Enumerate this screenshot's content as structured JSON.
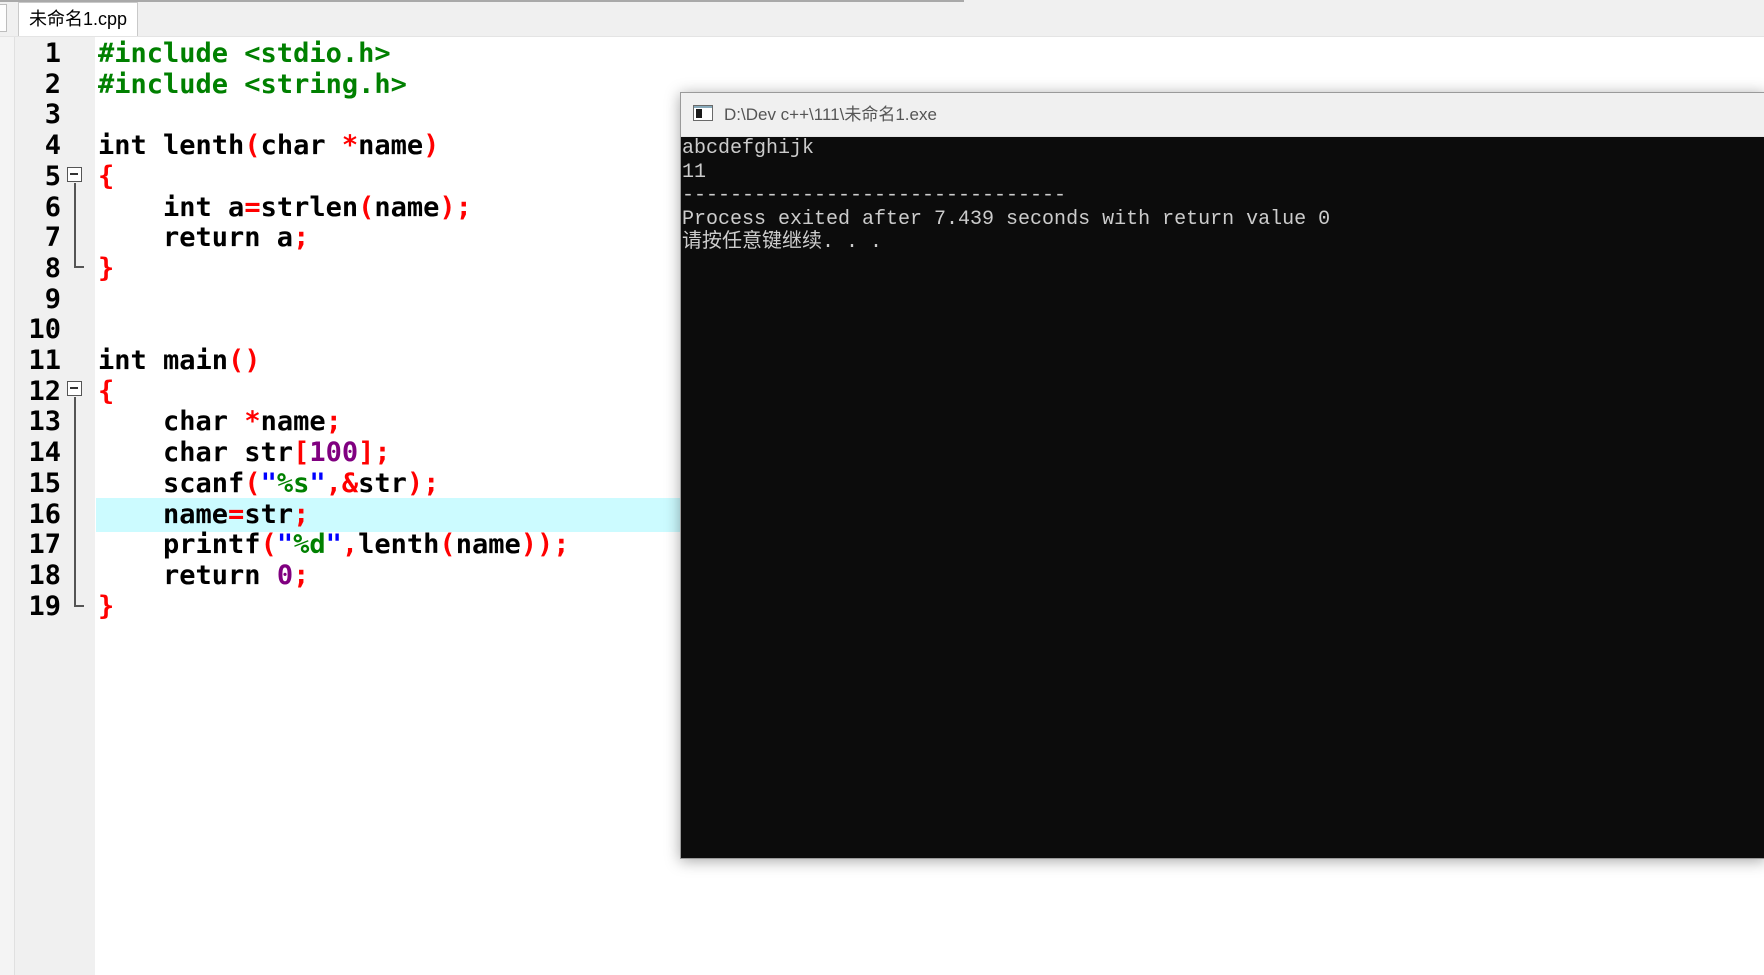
{
  "tab": {
    "label": "未命名1.cpp"
  },
  "editor": {
    "lines": [
      {
        "n": "1",
        "tokens": [
          [
            "pre",
            "#include <stdio.h>"
          ]
        ]
      },
      {
        "n": "2",
        "tokens": [
          [
            "pre",
            "#include <string.h>"
          ]
        ]
      },
      {
        "n": "3",
        "tokens": []
      },
      {
        "n": "4",
        "tokens": [
          [
            "kw",
            "int"
          ],
          [
            "kw",
            " lenth"
          ],
          [
            "op",
            "("
          ],
          [
            "kw",
            "char "
          ],
          [
            "op",
            "*"
          ],
          [
            "kw",
            "name"
          ],
          [
            "op",
            ")"
          ]
        ]
      },
      {
        "n": "5",
        "tokens": [
          [
            "op",
            "{"
          ]
        ]
      },
      {
        "n": "6",
        "tokens": [
          [
            "kw",
            "    int a"
          ],
          [
            "op",
            "="
          ],
          [
            "kw",
            "strlen"
          ],
          [
            "op",
            "("
          ],
          [
            "kw",
            "name"
          ],
          [
            "op",
            ");"
          ]
        ]
      },
      {
        "n": "7",
        "tokens": [
          [
            "kw",
            "    return a"
          ],
          [
            "op",
            ";"
          ]
        ]
      },
      {
        "n": "8",
        "tokens": [
          [
            "op",
            "}"
          ]
        ]
      },
      {
        "n": "9",
        "tokens": []
      },
      {
        "n": "10",
        "tokens": []
      },
      {
        "n": "11",
        "tokens": [
          [
            "kw",
            "int main"
          ],
          [
            "op",
            "()"
          ]
        ]
      },
      {
        "n": "12",
        "tokens": [
          [
            "op",
            "{"
          ]
        ]
      },
      {
        "n": "13",
        "tokens": [
          [
            "kw",
            "    char "
          ],
          [
            "op",
            "*"
          ],
          [
            "kw",
            "name"
          ],
          [
            "op",
            ";"
          ]
        ]
      },
      {
        "n": "14",
        "tokens": [
          [
            "kw",
            "    char str"
          ],
          [
            "op",
            "["
          ],
          [
            "num",
            "100"
          ],
          [
            "op",
            "];"
          ]
        ]
      },
      {
        "n": "15",
        "tokens": [
          [
            "kw",
            "    scanf"
          ],
          [
            "op",
            "("
          ],
          [
            "str",
            "\""
          ],
          [
            "fmt",
            "%s"
          ],
          [
            "str",
            "\""
          ],
          [
            "op",
            ",&"
          ],
          [
            "kw",
            "str"
          ],
          [
            "op",
            ");"
          ]
        ]
      },
      {
        "n": "16",
        "tokens": [
          [
            "kw",
            "    name"
          ],
          [
            "op",
            "="
          ],
          [
            "kw",
            "str"
          ],
          [
            "op",
            ";"
          ]
        ]
      },
      {
        "n": "17",
        "tokens": [
          [
            "kw",
            "    printf"
          ],
          [
            "op",
            "("
          ],
          [
            "str",
            "\""
          ],
          [
            "fmt",
            "%d"
          ],
          [
            "str",
            "\""
          ],
          [
            "op",
            ","
          ],
          [
            "kw",
            "lenth"
          ],
          [
            "op",
            "("
          ],
          [
            "kw",
            "name"
          ],
          [
            "op",
            "));"
          ]
        ]
      },
      {
        "n": "18",
        "tokens": [
          [
            "kw",
            "    return "
          ],
          [
            "num",
            "0"
          ],
          [
            "op",
            ";"
          ]
        ]
      },
      {
        "n": "19",
        "tokens": [
          [
            "op",
            "}"
          ]
        ]
      }
    ],
    "active_line": 16
  },
  "console": {
    "title": "D:\\Dev c++\\111\\未命名1.exe",
    "output": [
      "abcdefghijk",
      "11",
      "--------------------------------",
      "Process exited after 7.439 seconds with return value 0",
      "请按任意键继续. . ."
    ]
  }
}
